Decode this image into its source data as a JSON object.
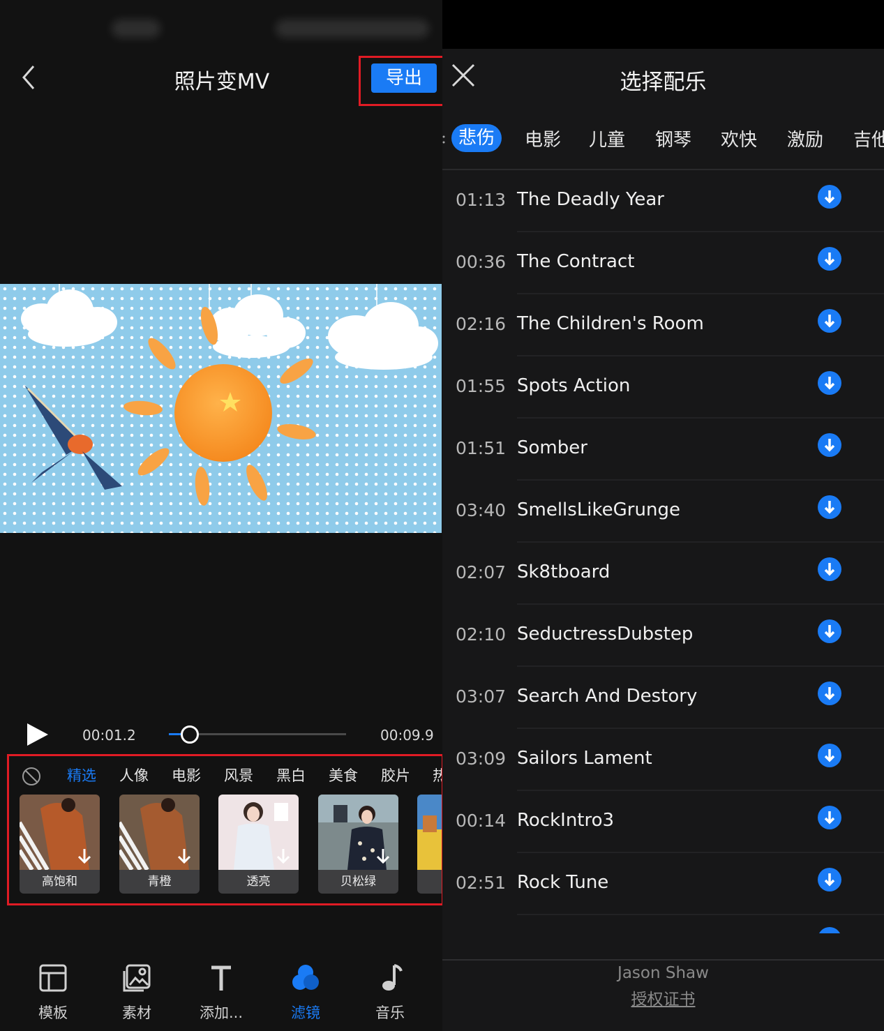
{
  "editor": {
    "title": "照片变MV",
    "export_label": "导出",
    "player": {
      "current_time": "00:01.2",
      "total_time": "00:09.9",
      "progress": 0.12
    },
    "filter_tabs": [
      "精选",
      "人像",
      "电影",
      "风景",
      "黑白",
      "美食",
      "胶片",
      "热"
    ],
    "filter_active_tab": "精选",
    "filters": [
      {
        "label": "高饱和"
      },
      {
        "label": "青橙"
      },
      {
        "label": "透亮"
      },
      {
        "label": "贝松绿"
      }
    ],
    "bottom_nav": [
      {
        "label": "模板",
        "icon": "template-icon"
      },
      {
        "label": "素材",
        "icon": "media-icon"
      },
      {
        "label": "添加...",
        "icon": "text-icon"
      },
      {
        "label": "滤镜",
        "icon": "filter-icon",
        "active": true
      },
      {
        "label": "音乐",
        "icon": "music-note-icon"
      }
    ]
  },
  "music_panel": {
    "title": "选择配乐",
    "categories": [
      "悲伤",
      "电影",
      "儿童",
      "钢琴",
      "欢快",
      "激励",
      "吉他"
    ],
    "active_category": "悲伤",
    "songs": [
      {
        "duration": "01:13",
        "name": "The Deadly Year"
      },
      {
        "duration": "00:36",
        "name": "The Contract"
      },
      {
        "duration": "02:16",
        "name": "The Children's Room"
      },
      {
        "duration": "01:55",
        "name": "Spots Action"
      },
      {
        "duration": "01:51",
        "name": "Somber"
      },
      {
        "duration": "03:40",
        "name": "SmellsLikeGrunge"
      },
      {
        "duration": "02:07",
        "name": "Sk8tboard"
      },
      {
        "duration": "02:10",
        "name": "SeductressDubstep"
      },
      {
        "duration": "03:07",
        "name": "Search And Destory"
      },
      {
        "duration": "03:09",
        "name": "Sailors Lament"
      },
      {
        "duration": "00:14",
        "name": "RockIntro3"
      },
      {
        "duration": "02:51",
        "name": "Rock Tune"
      }
    ],
    "footer": {
      "artist": "Jason Shaw",
      "certificate_link": "授权证书"
    }
  },
  "colors": {
    "accent": "#1a7bf5",
    "highlight_box": "#e01b24",
    "background": "#121212"
  }
}
